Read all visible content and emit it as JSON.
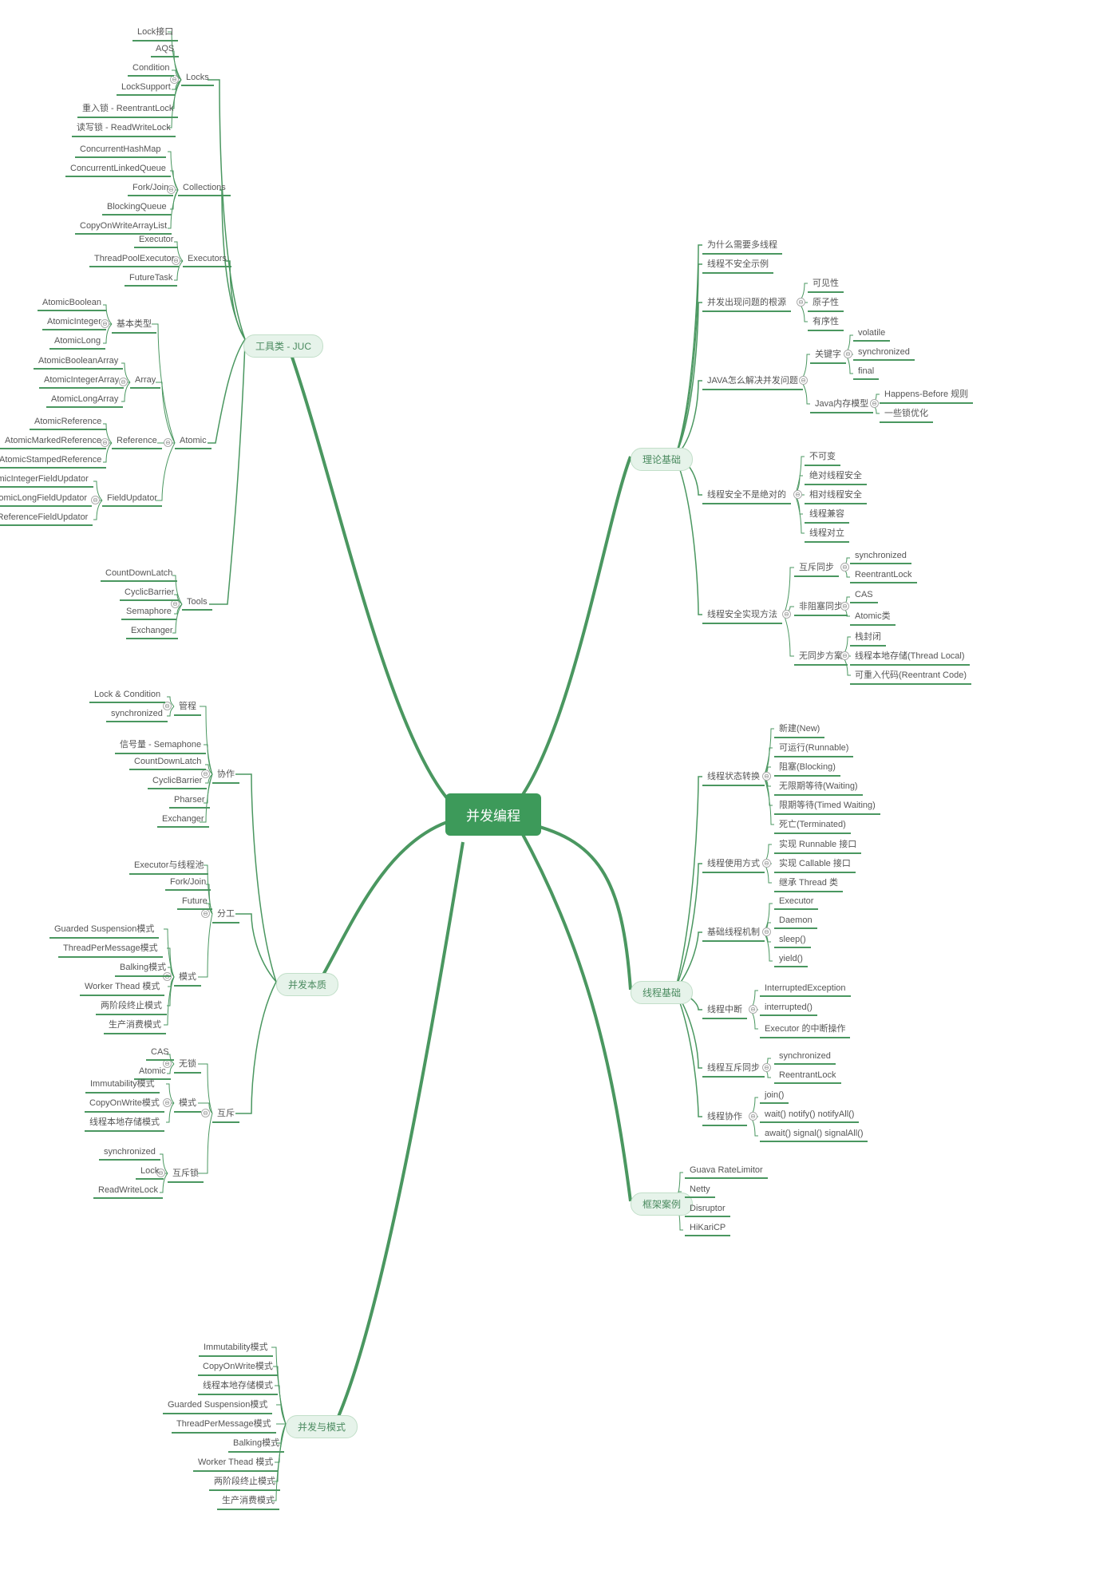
{
  "root": "并发编程",
  "branches": {
    "juc": "工具类 - JUC",
    "theory": "理论基础",
    "thread": "线程基础",
    "framework": "框架案例",
    "essence": "并发本质",
    "pattern": "并发与模式"
  },
  "juc": {
    "locks": {
      "label": "Locks",
      "items": [
        "Lock接口",
        "AQS",
        "Condition",
        "LockSupport",
        "重入锁 - ReentrantLock",
        "读写锁 - ReadWriteLock"
      ]
    },
    "collections": {
      "label": "Collections",
      "items": [
        "ConcurrentHashMap",
        "ConcurrentLinkedQueue",
        "Fork/Join",
        "BlockingQueue",
        "CopyOnWriteArrayList"
      ]
    },
    "executors": {
      "label": "Executors",
      "items": [
        "Executor",
        "ThreadPoolExecutor",
        "FutureTask"
      ]
    },
    "atomic": {
      "label": "Atomic",
      "basic": {
        "label": "基本类型",
        "items": [
          "AtomicBoolean",
          "AtomicInteger",
          "AtomicLong"
        ]
      },
      "array": {
        "label": "Array",
        "items": [
          "AtomicBooleanArray",
          "AtomicIntegerArray",
          "AtomicLongArray"
        ]
      },
      "reference": {
        "label": "Reference",
        "items": [
          "AtomicReference",
          "AtomicMarkedReference",
          "AtomicStampedReference"
        ]
      },
      "updator": {
        "label": "FieldUpdator",
        "items": [
          "AtomicIntegerFieldUpdator",
          "AtomicLongFieldUpdator",
          "AtomicReferenceFieldUpdator"
        ]
      }
    },
    "tools": {
      "label": "Tools",
      "items": [
        "CountDownLatch",
        "CyclicBarrier",
        "Semaphore",
        "Exchanger"
      ]
    }
  },
  "theory": {
    "why": "为什么需要多线程",
    "unsafe": "线程不安全示例",
    "root": {
      "label": "并发出现问题的根源",
      "items": [
        "可见性",
        "原子性",
        "有序性"
      ]
    },
    "solve": {
      "label": "JAVA怎么解决并发问题",
      "keyword": {
        "label": "关键字",
        "items": [
          "volatile",
          "synchronized",
          "final"
        ]
      },
      "jmm": {
        "label": "Java内存模型",
        "items": [
          "Happens-Before 规则",
          "一些锁优化"
        ]
      }
    },
    "notabs": {
      "label": "线程安全不是绝对的",
      "items": [
        "不可变",
        "绝对线程安全",
        "相对线程安全",
        "线程兼容",
        "线程对立"
      ]
    },
    "impl": {
      "label": "线程安全实现方法",
      "mutex": {
        "label": "互斥同步",
        "items": [
          "synchronized",
          "ReentrantLock"
        ]
      },
      "nonblock": {
        "label": "非阻塞同步",
        "items": [
          "CAS",
          "Atomic类"
        ]
      },
      "nosync": {
        "label": "无同步方案",
        "items": [
          "栈封闭",
          "线程本地存储(Thread Local)",
          "可重入代码(Reentrant Code)"
        ]
      }
    }
  },
  "thread": {
    "state": {
      "label": "线程状态转换",
      "items": [
        "新建(New)",
        "可运行(Runnable)",
        "阻塞(Blocking)",
        "无限期等待(Waiting)",
        "限期等待(Timed Waiting)",
        "死亡(Terminated)"
      ]
    },
    "use": {
      "label": "线程使用方式",
      "items": [
        "实现 Runnable 接口",
        "实现 Callable 接口",
        "继承 Thread 类"
      ]
    },
    "mech": {
      "label": "基础线程机制",
      "items": [
        "Executor",
        "Daemon",
        "sleep()",
        "yield()"
      ]
    },
    "intr": {
      "label": "线程中断",
      "items": [
        "InterruptedException",
        "interrupted()",
        "Executor 的中断操作"
      ]
    },
    "sync": {
      "label": "线程互斥同步",
      "items": [
        "synchronized",
        "ReentrantLock"
      ]
    },
    "coop": {
      "label": "线程协作",
      "items": [
        "join()",
        "wait() notify() notifyAll()",
        "await() signal() signalAll()"
      ]
    }
  },
  "framework": {
    "items": [
      "Guava RateLimitor",
      "Netty",
      "Disruptor",
      "HiKariCP"
    ]
  },
  "essence": {
    "coop": {
      "label": "协作",
      "monitor": {
        "label": "管程",
        "items": [
          "Lock & Condition",
          "synchronized"
        ]
      },
      "sema": "信号量 - Semaphone",
      "tools": [
        "CountDownLatch",
        "CyclicBarrier",
        "Pharser",
        "Exchanger"
      ]
    },
    "div": {
      "label": "分工",
      "basic": [
        "Executor与线程池",
        "Fork/Join",
        "Future"
      ],
      "pattern": {
        "label": "模式",
        "items": [
          "Guarded Suspension模式",
          "ThreadPerMessage模式",
          "Balking模式",
          "Worker Thead 模式",
          "两阶段终止模式",
          "生产消费模式"
        ]
      }
    },
    "mutex": {
      "label": "互斥",
      "lockfree": {
        "label": "无锁",
        "items": [
          "CAS",
          "Atomic"
        ]
      },
      "pattern": {
        "label": "模式",
        "items": [
          "Immutability模式",
          "CopyOnWrite模式",
          "线程本地存储模式"
        ]
      },
      "lock": {
        "label": "互斥锁",
        "items": [
          "synchronized",
          "Lock",
          "ReadWriteLock"
        ]
      }
    }
  },
  "pattern": {
    "items": [
      "Immutability模式",
      "CopyOnWrite模式",
      "线程本地存储模式",
      "Guarded Suspension模式",
      "ThreadPerMessage模式",
      "Balking模式",
      "Worker Thead 模式",
      "两阶段终止模式",
      "生产消费模式"
    ]
  }
}
